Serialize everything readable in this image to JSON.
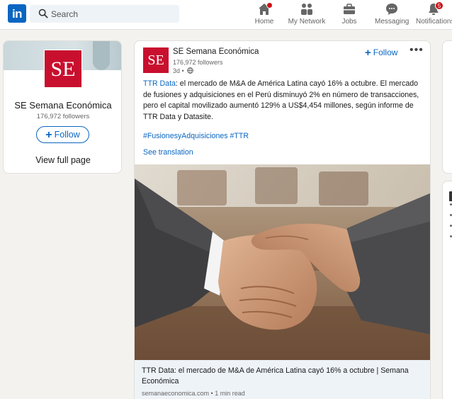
{
  "nav": {
    "logo": "in",
    "search_placeholder": "Search",
    "items": [
      {
        "label": "Home",
        "icon": "home-icon",
        "badge": "dot"
      },
      {
        "label": "My Network",
        "icon": "network-icon"
      },
      {
        "label": "Jobs",
        "icon": "briefcase-icon"
      },
      {
        "label": "Messaging",
        "icon": "chat-icon"
      },
      {
        "label": "Notifications",
        "icon": "bell-icon",
        "badge_count": "5"
      }
    ]
  },
  "company_card": {
    "logo_text": "SE",
    "name": "SE Semana Económica",
    "followers": "176,972 followers",
    "follow_label": "Follow",
    "view_label": "View full page"
  },
  "post": {
    "logo_text": "SE",
    "author": "SE Semana Económica",
    "followers": "176,972 followers",
    "time": "3d •",
    "follow_label": "Follow",
    "more_label": "•••",
    "text_keyword": "TTR Data",
    "text_body": ": el mercado de M&A de América Latina cayó 16% a octubre. El mercado de fusiones y adquisiciones en el Perú disminuyó 2% en número de transacciones, pero el capital movilizado aumentó 129% a US$4,454 millones, según informe de TTR Data y Datasite.",
    "hashtags": "#FusionesyAdquisiciones #TTR",
    "see_translation": "See translation",
    "image_alt": "handshake",
    "link_title": "TTR Data: el mercado de M&A de América Latina cayó 16% a octubre | Semana Económica",
    "link_meta": "semanaeconomica.com • 1 min read"
  },
  "colors": {
    "brand_blue": "#0a66c2",
    "se_red": "#c8102e",
    "badge_red": "#cc1016",
    "background": "#f3f2ef"
  }
}
